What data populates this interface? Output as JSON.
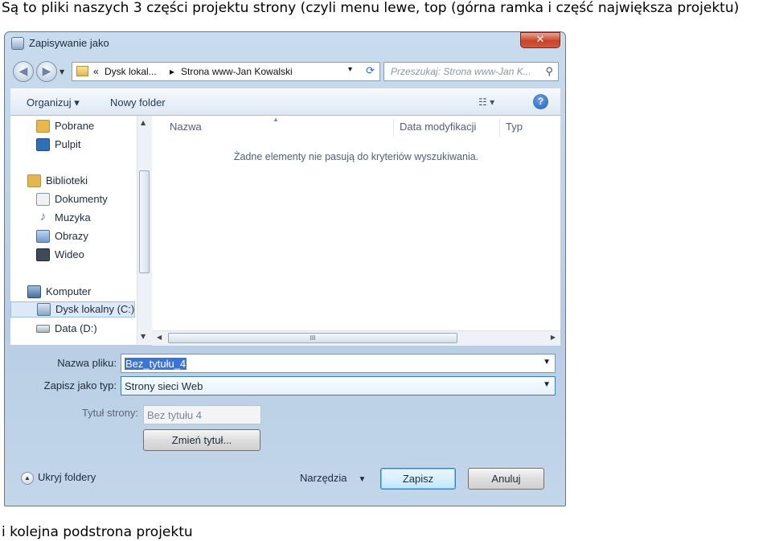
{
  "captions": {
    "top": "Są to pliki naszych 3 części projektu strony (czyli menu lewe, top (górna ramka i część największa projektu)",
    "bottom": "i kolejna podstrona projektu"
  },
  "window": {
    "title": "Zapisywanie jako",
    "close_glyph": "✕"
  },
  "address_bar": {
    "back_glyph": "◀",
    "forward_glyph": "▶",
    "prefix": "«",
    "segment1": "Dysk lokal...",
    "separator": "▸",
    "segment2": "Strona www-Jan Kowalski",
    "dropdown_glyph": "▾",
    "refresh_glyph": "⟳"
  },
  "search": {
    "placeholder": "Przeszukaj: Strona www-Jan K...",
    "icon_glyph": "⚲"
  },
  "toolbar": {
    "organize": "Organizuj ▾",
    "new_folder": "Nowy folder",
    "views_glyph": "☷ ▾",
    "help_glyph": "?"
  },
  "nav_pane": {
    "items": [
      {
        "label": "Pobrane",
        "icon": "downloads-icon",
        "color": "#e9b84a"
      },
      {
        "label": "Pulpit",
        "icon": "desktop-icon",
        "color": "#2f6fb5"
      },
      {
        "label": "Biblioteki",
        "icon": "libraries-icon",
        "color": "#e3b750"
      },
      {
        "label": "Dokumenty",
        "icon": "documents-icon",
        "color": "#d8dee6"
      },
      {
        "label": "Muzyka",
        "icon": "music-icon",
        "color": "#3a7bd5"
      },
      {
        "label": "Obrazy",
        "icon": "pictures-icon",
        "color": "#6f9ccf"
      },
      {
        "label": "Wideo",
        "icon": "video-icon",
        "color": "#3d4a5a"
      },
      {
        "label": "Komputer",
        "icon": "computer-icon",
        "color": "#4c6e99"
      },
      {
        "label": "Dysk lokalny (C:)",
        "icon": "drive-c-icon",
        "color": "#8aa6c4"
      },
      {
        "label": "Data (D:)",
        "icon": "drive-d-icon",
        "color": "#a8b3bf"
      }
    ]
  },
  "file_list": {
    "columns": [
      "Nazwa",
      "Data modyfikacji",
      "Typ"
    ],
    "empty_message": "Żadne elementy nie pasują do kryteriów wyszukiwania.",
    "scroll_grip": "III"
  },
  "form": {
    "filename_label": "Nazwa pliku:",
    "filename_value": "Bez_tytułu_4",
    "filetype_label": "Zapisz jako typ:",
    "filetype_value": "Strony sieci Web",
    "page_title_label": "Tytuł strony:",
    "page_title_value": "Bez tytułu 4",
    "change_title_button": "Zmień tytuł..."
  },
  "footer": {
    "hide_folders": "Ukryj foldery",
    "tools": "Narzędzia",
    "save": "Zapisz",
    "cancel": "Anuluj"
  }
}
